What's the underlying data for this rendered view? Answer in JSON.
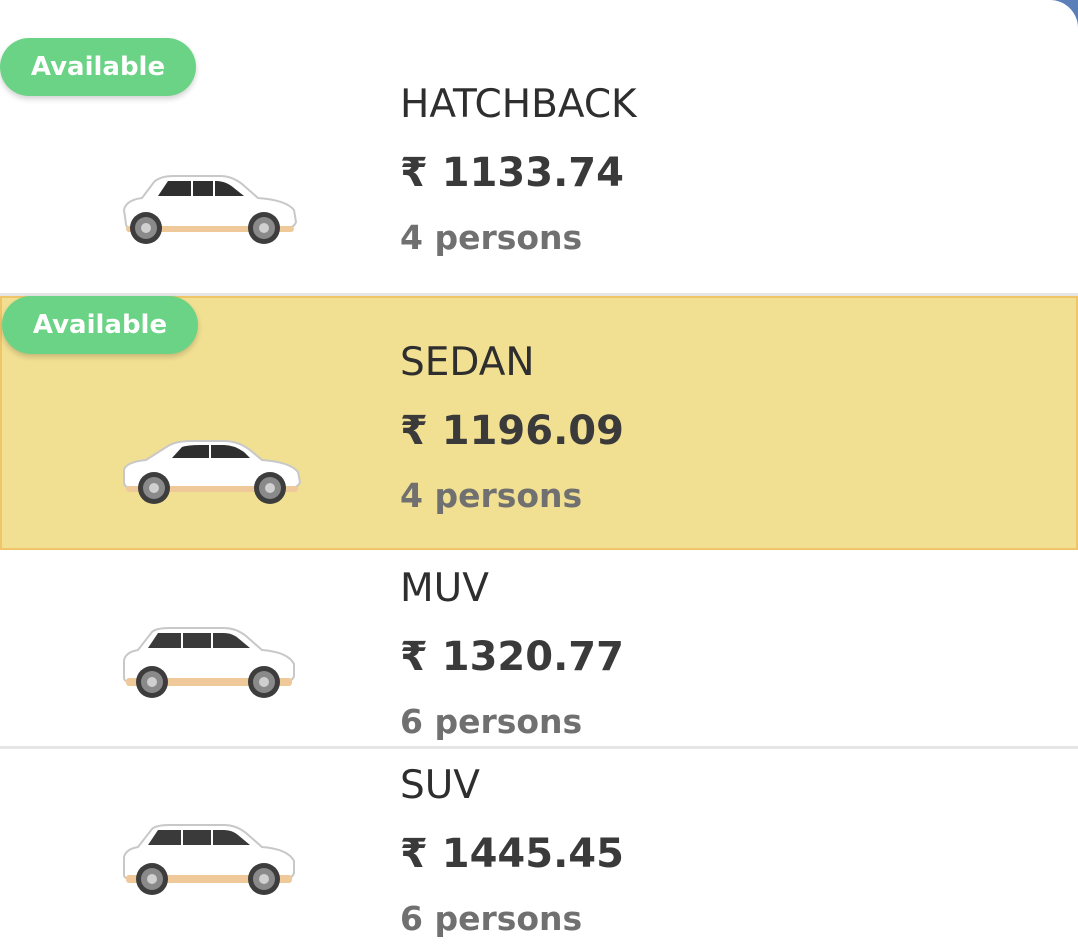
{
  "vehicles": [
    {
      "name": "HATCHBACK",
      "price": "₹ 1133.74",
      "capacity": "4 persons",
      "badge": "Available",
      "selected": false,
      "car_icon": "hatchback-car-icon"
    },
    {
      "name": "SEDAN",
      "price": "₹ 1196.09",
      "capacity": "4 persons",
      "badge": "Available",
      "selected": true,
      "car_icon": "sedan-car-icon"
    },
    {
      "name": "MUV",
      "price": "₹ 1320.77",
      "capacity": "6 persons",
      "badge": "",
      "selected": false,
      "car_icon": "muv-car-icon"
    },
    {
      "name": "SUV",
      "price": "₹ 1445.45",
      "capacity": "6 persons",
      "badge": "",
      "selected": false,
      "car_icon": "suv-car-icon"
    }
  ],
  "colors": {
    "selected_background": "#f2e092",
    "selected_border": "#f0c56a",
    "badge_background": "#6bd385",
    "car_body": "#ffffff",
    "car_trim": "#f0c99a"
  }
}
